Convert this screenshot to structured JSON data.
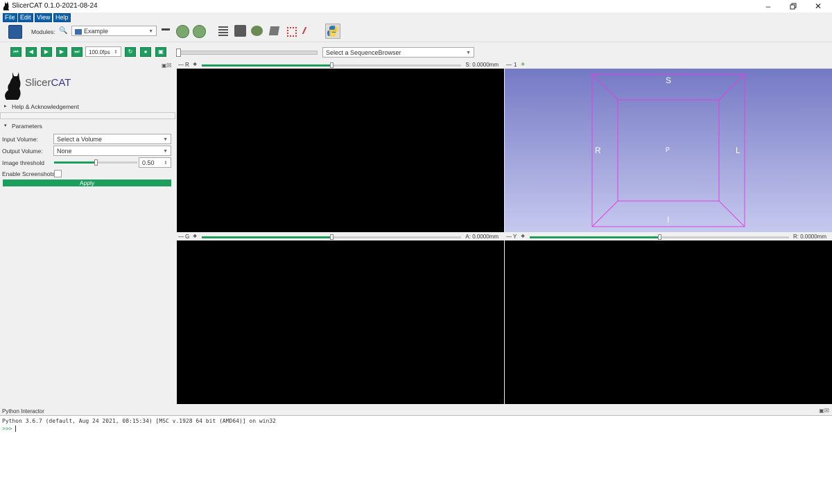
{
  "window": {
    "title": "SlicerCAT 0.1.0-2021-08-24"
  },
  "menu": {
    "items": [
      "File",
      "Edit",
      "View",
      "Help"
    ]
  },
  "toolbar": {
    "modules_label": "Modules:",
    "module_selected": "Example"
  },
  "sequence": {
    "fps": "100.0fps",
    "browser_placeholder": "Select a SequenceBrowser"
  },
  "logo": {
    "text_prefix": "Slicer",
    "text_suffix": "CAT"
  },
  "panel": {
    "help_section": "Help & Acknowledgement",
    "parameters_section": "Parameters",
    "input_volume_label": "Input Volume:",
    "input_volume_value": "Select a Volume",
    "output_volume_label": "Output Volume:",
    "output_volume_value": "None",
    "threshold_label": "Image threshold",
    "threshold_value": "0.50",
    "threshold_fraction": 0.5,
    "screenshots_label": "Enable Screenshots",
    "apply_label": "Apply"
  },
  "views": {
    "red": {
      "label": "R",
      "offset": "S: 0.0000mm",
      "position": 0.5
    },
    "threed": {
      "label": "1",
      "orient_top": "S",
      "orient_bottom": "I",
      "orient_left": "R",
      "orient_right": "L",
      "orient_center": "P"
    },
    "green": {
      "label": "G",
      "offset": "A: 0.0000mm",
      "position": 0.5
    },
    "yellow": {
      "label": "Y",
      "offset": "R: 0.0000mm",
      "position": 0.5
    }
  },
  "python": {
    "title": "Python Interactor",
    "banner": "Python 3.6.7 (default, Aug 24 2021, 08:15:34) [MSC v.1928 64 bit (AMD64)] on win32",
    "prompt": ">>>"
  },
  "colors": {
    "accent_green": "#1e9e5e",
    "menu_blue": "#0c5fa8",
    "threed_bg_top": "#7479c4",
    "threed_bg_bottom": "#c6c9ee",
    "box_magenta": "#e040e0"
  }
}
